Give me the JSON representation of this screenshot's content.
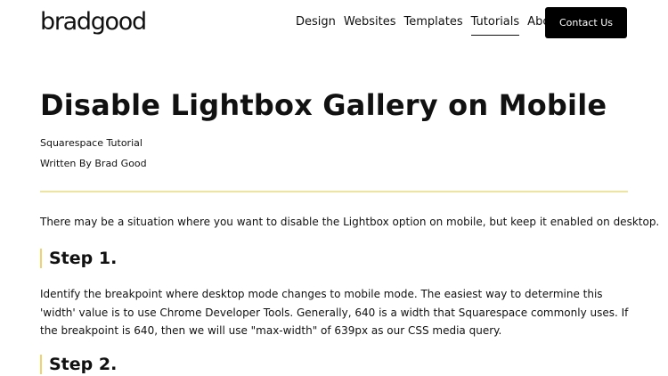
{
  "header": {
    "logo": "bradgood",
    "nav": [
      {
        "label": "Design"
      },
      {
        "label": "Websites"
      },
      {
        "label": "Templates"
      },
      {
        "label": "Tutorials"
      },
      {
        "label": "About"
      }
    ],
    "active_nav": "Tutorials",
    "contact_label": "Contact Us"
  },
  "article": {
    "title": "Disable Lightbox Gallery on Mobile",
    "category": "Squarespace Tutorial",
    "author": "Written By Brad Good",
    "intro": "There may be a situation where you want to disable the Lightbox option on mobile, but keep it enabled on desktop.",
    "steps": [
      {
        "heading": "Step 1.",
        "body": "Identify the breakpoint where desktop mode changes to mobile mode. The easiest way to determine this 'width' value is to use Chrome Developer Tools. Generally, 640 is a width that Squarespace commonly uses. If the breakpoint is 640, then we will use \"max-width\" of 639px as our CSS media query."
      },
      {
        "heading": "Step 2."
      }
    ]
  },
  "colors": {
    "accent_yellow": "#f1d36b",
    "divider": "#efe3a0",
    "button_bg": "#000000",
    "text": "#111111"
  }
}
